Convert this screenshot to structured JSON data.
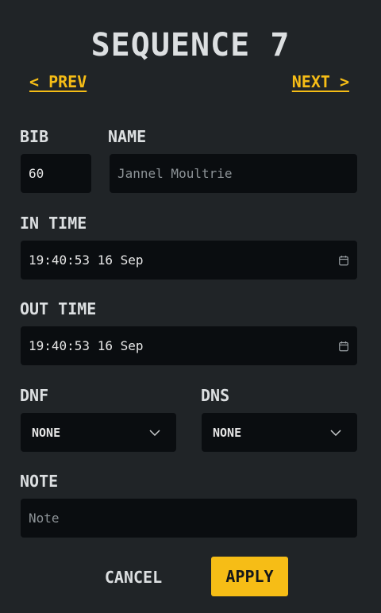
{
  "header": {
    "title": "SEQUENCE 7",
    "prev_label": "< PREV",
    "next_label": "NEXT >"
  },
  "form": {
    "bib": {
      "label": "BIB",
      "value": "60"
    },
    "name": {
      "label": "NAME",
      "placeholder": "Jannel Moultrie"
    },
    "in_time": {
      "label": "IN TIME",
      "value": "19:40:53 16 Sep",
      "icon": "calendar-icon"
    },
    "out_time": {
      "label": "OUT TIME",
      "value": "19:40:53 16 Sep",
      "icon": "calendar-icon"
    },
    "dnf": {
      "label": "DNF",
      "value": "NONE",
      "icon": "chevron-down-icon"
    },
    "dns": {
      "label": "DNS",
      "value": "NONE",
      "icon": "chevron-down-icon"
    },
    "note": {
      "label": "NOTE",
      "placeholder": "Note"
    }
  },
  "actions": {
    "cancel_label": "CANCEL",
    "apply_label": "APPLY"
  },
  "colors": {
    "background": "#202427",
    "field_background": "#0a0d10",
    "accent": "#f6bd16",
    "text": "#dcdfe1",
    "placeholder": "#8c9296"
  }
}
